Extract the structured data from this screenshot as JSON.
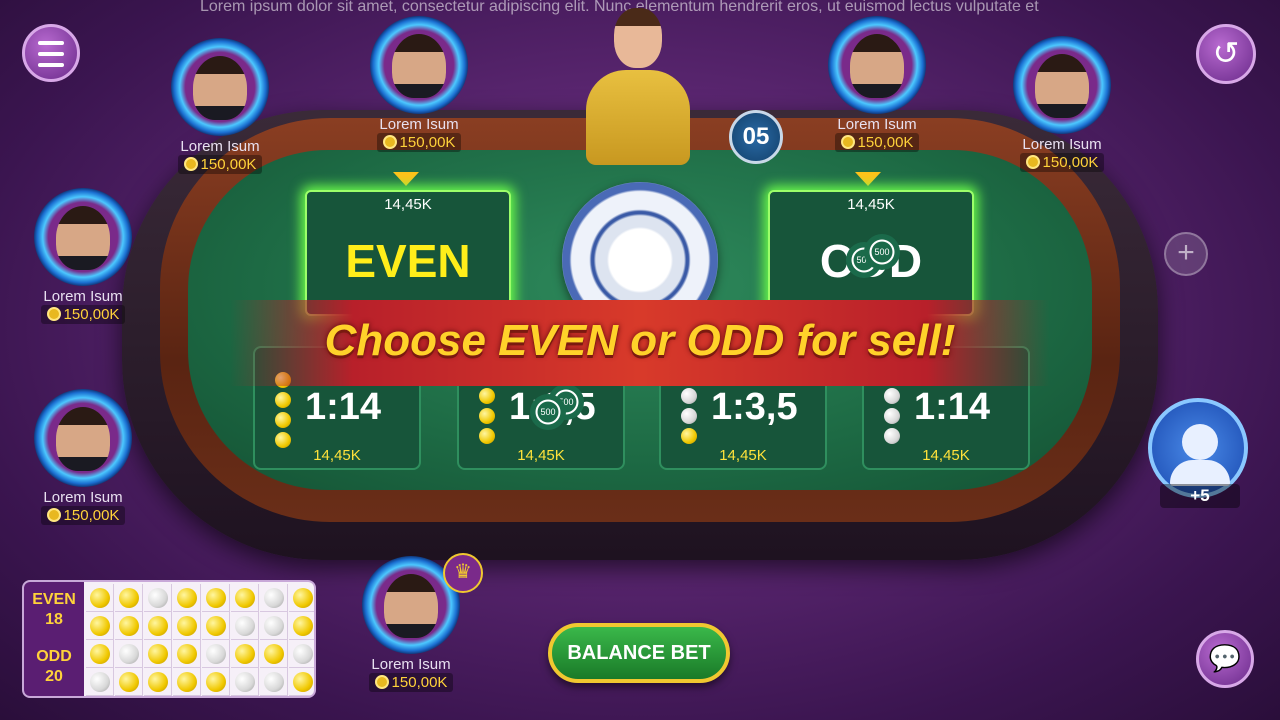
{
  "ticker": "Lorem ipsum dolor sit amet, consectetur adipiscing elit. Nunc elementum hendrerit eros, ut euismod lectus vulputate et",
  "timer": "05",
  "banner": "Choose EVEN or ODD for sell!",
  "players": [
    {
      "name": "Lorem Isum",
      "money": "150,00K"
    },
    {
      "name": "Lorem Isum",
      "money": "150,00K"
    },
    {
      "name": "Lorem Isum",
      "money": "150,00K"
    },
    {
      "name": "Lorem Isum",
      "money": "150,00K"
    },
    {
      "name": "Lorem Isum",
      "money": "150,00K"
    },
    {
      "name": "Lorem Isum",
      "money": "150,00K"
    },
    {
      "name": "Lorem Isum",
      "money": "150,00K"
    }
  ],
  "bets": {
    "even": {
      "label": "EVEN",
      "amount": "14,45K"
    },
    "odd": {
      "label": "ODD",
      "amount": "14,45K"
    },
    "small": [
      {
        "ratio": "1:14",
        "amount": "14,45K",
        "dots": [
          "y",
          "y",
          "y",
          "y"
        ]
      },
      {
        "ratio": "1:3,5",
        "amount": "14,45K",
        "dots": [
          "y",
          "y",
          "y"
        ]
      },
      {
        "ratio": "1:3,5",
        "amount": "14,45K",
        "dots": [
          "w",
          "w",
          "y"
        ]
      },
      {
        "ratio": "1:14",
        "amount": "14,45K",
        "dots": [
          "w",
          "w",
          "w"
        ]
      }
    ]
  },
  "chips": {
    "value": "500"
  },
  "others_count": "+5",
  "history": {
    "even_label": "EVEN",
    "even_count": "18",
    "odd_label": "ODD",
    "odd_count": "20",
    "rows": [
      [
        "y",
        "y",
        "w",
        "y",
        "y",
        "y",
        "w",
        "y"
      ],
      [
        "y",
        "y",
        "y",
        "y",
        "y",
        "w",
        "w",
        "y"
      ],
      [
        "y",
        "w",
        "y",
        "y",
        "w",
        "y",
        "y",
        "w"
      ],
      [
        "w",
        "y",
        "y",
        "y",
        "y",
        "w",
        "w",
        "y"
      ]
    ]
  },
  "balance_bet": "BALANCE BET",
  "colors": {
    "accent": "#ffd22a",
    "felt": "#1d6a44",
    "banner": "#d83a2a"
  }
}
